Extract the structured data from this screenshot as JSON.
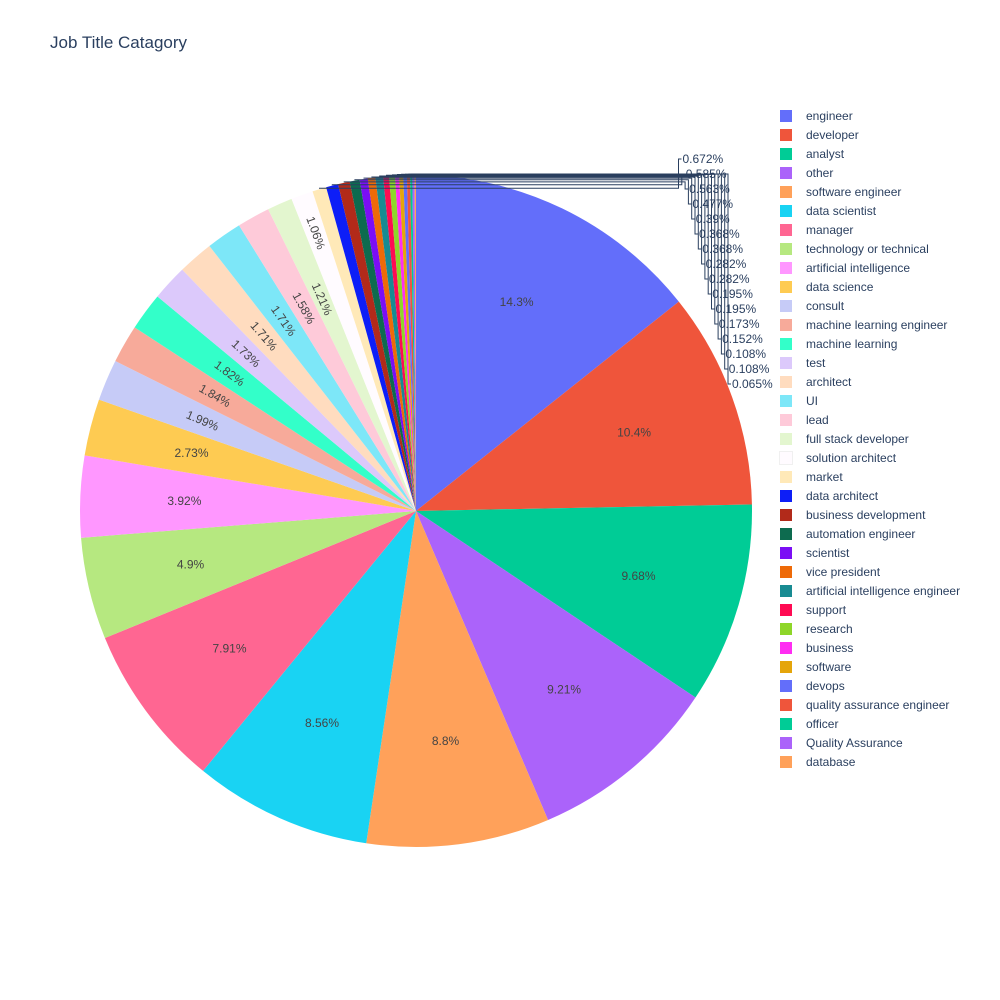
{
  "chart_data": {
    "type": "pie",
    "title": "Job Title Catagory",
    "slices": [
      {
        "label": "engineer",
        "value": 14.3,
        "text": "14.3%",
        "color": "#636efa",
        "inside": true
      },
      {
        "label": "developer",
        "value": 10.4,
        "text": "10.4%",
        "color": "#ef553b",
        "inside": true
      },
      {
        "label": "analyst",
        "value": 9.68,
        "text": "9.68%",
        "color": "#00cc96",
        "inside": true
      },
      {
        "label": "other",
        "value": 9.21,
        "text": "9.21%",
        "color": "#ab63fa",
        "inside": true
      },
      {
        "label": "software engineer",
        "value": 8.8,
        "text": "8.8%",
        "color": "#ffa15a",
        "inside": true
      },
      {
        "label": "data scientist",
        "value": 8.56,
        "text": "8.56%",
        "color": "#19d3f3",
        "inside": true
      },
      {
        "label": "manager",
        "value": 7.91,
        "text": "7.91%",
        "color": "#ff6692",
        "inside": true
      },
      {
        "label": "technology or technical",
        "value": 4.9,
        "text": "4.9%",
        "color": "#b6e880",
        "inside": true
      },
      {
        "label": "artificial intelligence",
        "value": 3.92,
        "text": "3.92%",
        "color": "#ff97ff",
        "inside": true
      },
      {
        "label": "data science",
        "value": 2.73,
        "text": "2.73%",
        "color": "#fecb52",
        "inside": true
      },
      {
        "label": "consult",
        "value": 1.99,
        "text": "1.99%",
        "color": "#c6cbf7",
        "inside": true
      },
      {
        "label": "machine learning engineer",
        "value": 1.84,
        "text": "1.84%",
        "color": "#f7aa9a",
        "inside": true
      },
      {
        "label": "machine learning",
        "value": 1.82,
        "text": "1.82%",
        "color": "#33ffc9",
        "inside": true
      },
      {
        "label": "test",
        "value": 1.73,
        "text": "1.73%",
        "color": "#dcc9fb",
        "inside": true
      },
      {
        "label": "architect",
        "value": 1.71,
        "text": "1.71%",
        "color": "#ffdcbf",
        "inside": true
      },
      {
        "label": "UI",
        "value": 1.71,
        "text": "1.71%",
        "color": "#7de7f8",
        "inside": true
      },
      {
        "label": "lead",
        "value": 1.58,
        "text": "1.58%",
        "color": "#fecad9",
        "inside": true
      },
      {
        "label": "full stack developer",
        "value": 1.21,
        "text": "1.21%",
        "color": "#e3f6cf",
        "inside": true
      },
      {
        "label": "solution architect",
        "value": 1.06,
        "text": "1.06%",
        "color": "#fffbff",
        "inside": true
      },
      {
        "label": "market",
        "value": 0.672,
        "text": "0.672%",
        "color": "#ffe9b8",
        "inside": false
      },
      {
        "label": "data architect",
        "value": 0.585,
        "text": "0.585%",
        "color": "#0d1ef7",
        "inside": false
      },
      {
        "label": "business development",
        "value": 0.563,
        "text": "0.563%",
        "color": "#b22a1a",
        "inside": false
      },
      {
        "label": "automation engineer",
        "value": 0.477,
        "text": "0.477%",
        "color": "#0d6b4f",
        "inside": false
      },
      {
        "label": "scientist",
        "value": 0.39,
        "text": "0.39%",
        "color": "#7b0ef5",
        "inside": false
      },
      {
        "label": "vice president",
        "value": 0.368,
        "text": "0.368%",
        "color": "#ee6a08",
        "inside": false
      },
      {
        "label": "artificial intelligence engineer",
        "value": 0.368,
        "text": "0.368%",
        "color": "#188b92",
        "inside": false
      },
      {
        "label": "support",
        "value": 0.282,
        "text": "0.282%",
        "color": "#ff0b53",
        "inside": false
      },
      {
        "label": "research",
        "value": 0.282,
        "text": "0.282%",
        "color": "#8ed629",
        "inside": false
      },
      {
        "label": "business",
        "value": 0.195,
        "text": "0.195%",
        "color": "#ff2df2",
        "inside": false
      },
      {
        "label": "software",
        "value": 0.195,
        "text": "0.195%",
        "color": "#e5a50a",
        "inside": false
      },
      {
        "label": "devops",
        "value": 0.173,
        "text": "0.173%",
        "color": "#636efa",
        "inside": false
      },
      {
        "label": "quality assurance engineer",
        "value": 0.152,
        "text": "0.152%",
        "color": "#ef553b",
        "inside": false
      },
      {
        "label": "officer",
        "value": 0.108,
        "text": "0.108%",
        "color": "#00cc96",
        "inside": false
      },
      {
        "label": "Quality Assurance",
        "value": 0.108,
        "text": "0.108%",
        "color": "#ab63fa",
        "inside": false
      },
      {
        "label": "database",
        "value": 0.065,
        "text": "0.065%",
        "color": "#ffa15a",
        "inside": false
      }
    ],
    "legend_position": "right",
    "direction": "clockwise",
    "start": "top"
  }
}
